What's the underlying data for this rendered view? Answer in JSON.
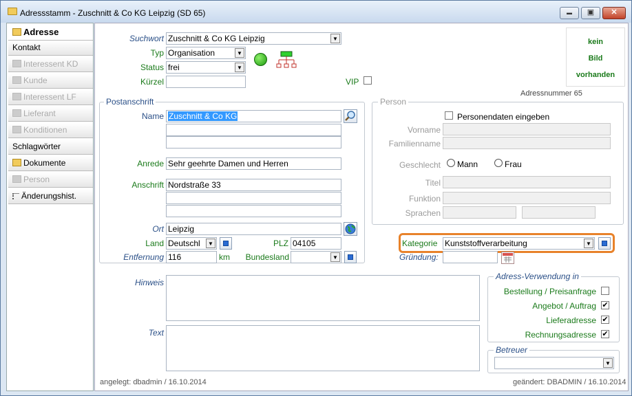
{
  "window": {
    "title": "Adressstamm - Zuschnitt & Co KG Leipzig (SD 65)",
    "controls": {
      "minimize": "▬",
      "maximize": "▣",
      "close": "✕"
    }
  },
  "sidebar": {
    "items": [
      {
        "label": "Adresse",
        "icon": "folder-open-icon"
      },
      {
        "label": "Kontakt"
      },
      {
        "label": "Interessent KD",
        "icon": "grey-square-icon"
      },
      {
        "label": "Kunde",
        "icon": "grey-square-icon"
      },
      {
        "label": "Interessent LF",
        "icon": "grey-square-icon"
      },
      {
        "label": "Lieferant",
        "icon": "grey-square-icon"
      },
      {
        "label": "Konditionen",
        "icon": "grey-square-icon"
      },
      {
        "label": "Schlagwörter"
      },
      {
        "label": "Dokumente",
        "icon": "folder-icon"
      },
      {
        "label": "Person",
        "icon": "grey-square-icon"
      },
      {
        "label": "Änderungshist.",
        "icon": "list-icon"
      }
    ]
  },
  "header": {
    "suchwort_label": "Suchwort",
    "suchwort_value": "Zuschnitt & Co KG Leipzig",
    "typ_label": "Typ",
    "typ_value": "Organisation",
    "status_label": "Status",
    "status_value": "frei",
    "kuerzel_label": "Kürzel",
    "kuerzel_value": "",
    "vip_label": "VIP",
    "image_text": [
      "kein",
      "Bild",
      "vorhanden"
    ],
    "adressnummer": "Adressnummer  65"
  },
  "postanschrift": {
    "title": "Postanschrift",
    "name_label": "Name",
    "name_value": "Zuschnitt & Co KG",
    "anrede_label": "Anrede",
    "anrede_value": "Sehr geehrte Damen und Herren",
    "anschrift_label": "Anschrift",
    "anschrift_value": "Nordstraße 33",
    "ort_label": "Ort",
    "ort_value": "Leipzig",
    "land_label": "Land",
    "land_value": "Deutschl",
    "plz_label": "PLZ",
    "plz_value": "04105",
    "entfernung_label": "Entfernung",
    "entfernung_value": "116",
    "entfernung_unit": "km",
    "bundesland_label": "Bundesland",
    "bundesland_value": ""
  },
  "person": {
    "title": "Person",
    "personendaten_label": "Personendaten eingeben",
    "vorname_label": "Vorname",
    "familienname_label": "Familienname",
    "geschlecht_label": "Geschlecht",
    "mann_label": "Mann",
    "frau_label": "Frau",
    "titel_label": "Titel",
    "funktion_label": "Funktion",
    "sprachen_label": "Sprachen"
  },
  "kategorie": {
    "label": "Kategorie",
    "value": "Kunststoffverarbeitung",
    "highlight_color": "#e8822a"
  },
  "gruendung": {
    "label": "Gründung:",
    "value": ""
  },
  "hinweis_label": "Hinweis",
  "text_label": "Text",
  "verwendung": {
    "title": "Adress-Verwendung in",
    "items": [
      {
        "label": "Bestellung / Preisanfrage",
        "checked": "false",
        "mark": ""
      },
      {
        "label": "Angebot / Auftrag",
        "checked": "true",
        "mark": "✔"
      },
      {
        "label": "Lieferadresse",
        "checked": "true",
        "mark": "✔"
      },
      {
        "label": "Rechnungsadresse",
        "checked": "true",
        "mark": "✔"
      }
    ]
  },
  "betreuer": {
    "title": "Betreuer",
    "value": ""
  },
  "footer": {
    "angelegt": "angelegt: dbadmin / 16.10.2014",
    "geaendert": "geändert: DBADMIN / 16.10.2014"
  }
}
